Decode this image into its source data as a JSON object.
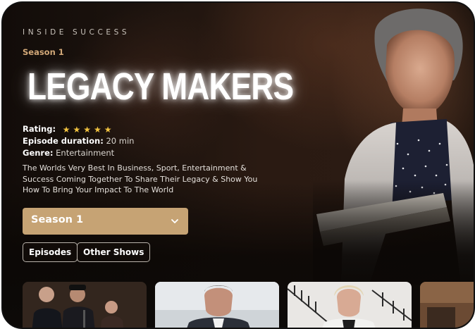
{
  "show": {
    "eyebrow": "INSIDE SUCCESS",
    "season_tag": "Season 1",
    "title": "LEGACY MAKERS",
    "rating_label": "Rating:",
    "rating_stars": 5,
    "duration_label": "Episode duration:",
    "duration_value": "20 min",
    "genre_label": "Genre:",
    "genre_value": "Entertainment",
    "description": "The Worlds Very Best In Business, Sport, Entertainment & Success Coming Together To Share Their Legacy & Show You How To Bring Your Impact To The World"
  },
  "season_select": {
    "selected": "Season 1"
  },
  "tabs": [
    {
      "label": "Episodes"
    },
    {
      "label": "Other Shows"
    }
  ],
  "colors": {
    "accent": "#c6a374",
    "season_tag": "#d2a878",
    "star": "#f3c440",
    "background": "#0c0907"
  },
  "icons": {
    "star": "star-icon",
    "dropdown": "chevron-down-icon"
  },
  "thumbnails": [
    {
      "name": "episode-thumb-panel"
    },
    {
      "name": "episode-thumb-man-suit"
    },
    {
      "name": "episode-thumb-woman-stairs"
    },
    {
      "name": "episode-thumb-partial"
    }
  ]
}
